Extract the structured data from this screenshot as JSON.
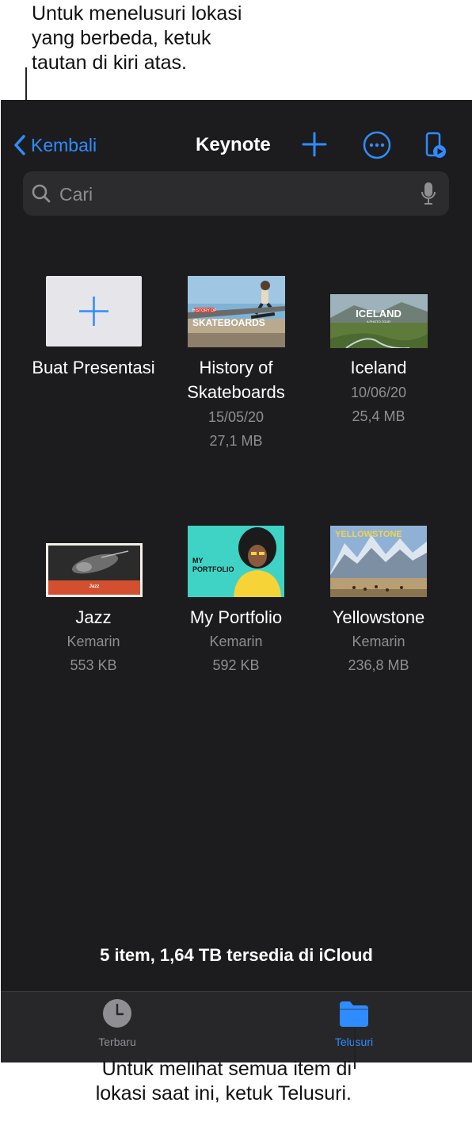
{
  "callouts": {
    "top": "Untuk menelusuri lokasi\nyang berbeda, ketuk\ntautan di kiri atas.",
    "bottom": "Untuk melihat semua item di\nlokasi saat ini, ketuk Telusuri."
  },
  "nav": {
    "back_label": "Kembali",
    "title": "Keynote",
    "icons": [
      "chevron-left-icon",
      "plus-icon",
      "more-icon",
      "device-play-icon"
    ]
  },
  "search": {
    "placeholder": "Cari",
    "value": ""
  },
  "create": {
    "label": "Buat Presentasi"
  },
  "documents": [
    {
      "name": "History of Skateboards",
      "date": "15/05/20",
      "size": "27,1 MB",
      "thumb_text": "SKATEBOARDS",
      "thumb_accent": "HISTORY OF"
    },
    {
      "name": "Iceland",
      "date": "10/06/20",
      "size": "25,4 MB",
      "thumb_text": "ICELAND",
      "thumb_accent": "A PHOTO TOUR"
    },
    {
      "name": "Jazz",
      "date": "Kemarin",
      "size": "553 KB",
      "thumb_text": "Jazz",
      "thumb_accent": ""
    },
    {
      "name": "My Portfolio",
      "date": "Kemarin",
      "size": "592 KB",
      "thumb_text": "MY\nPORTFOLIO",
      "thumb_accent": ""
    },
    {
      "name": "Yellowstone",
      "date": "Kemarin",
      "size": "236,8 MB",
      "thumb_text": "YELLOWSTONE",
      "thumb_accent": ""
    }
  ],
  "storage_text": "5 item, 1,64 TB tersedia di iCloud",
  "tabs": [
    {
      "label": "Terbaru",
      "icon": "clock-icon",
      "active": false
    },
    {
      "label": "Telusuri",
      "icon": "folder-icon",
      "active": true
    }
  ],
  "colors": {
    "accent": "#2f8cff",
    "background": "#1c1c1e",
    "secondary_text": "#8e8e93"
  }
}
